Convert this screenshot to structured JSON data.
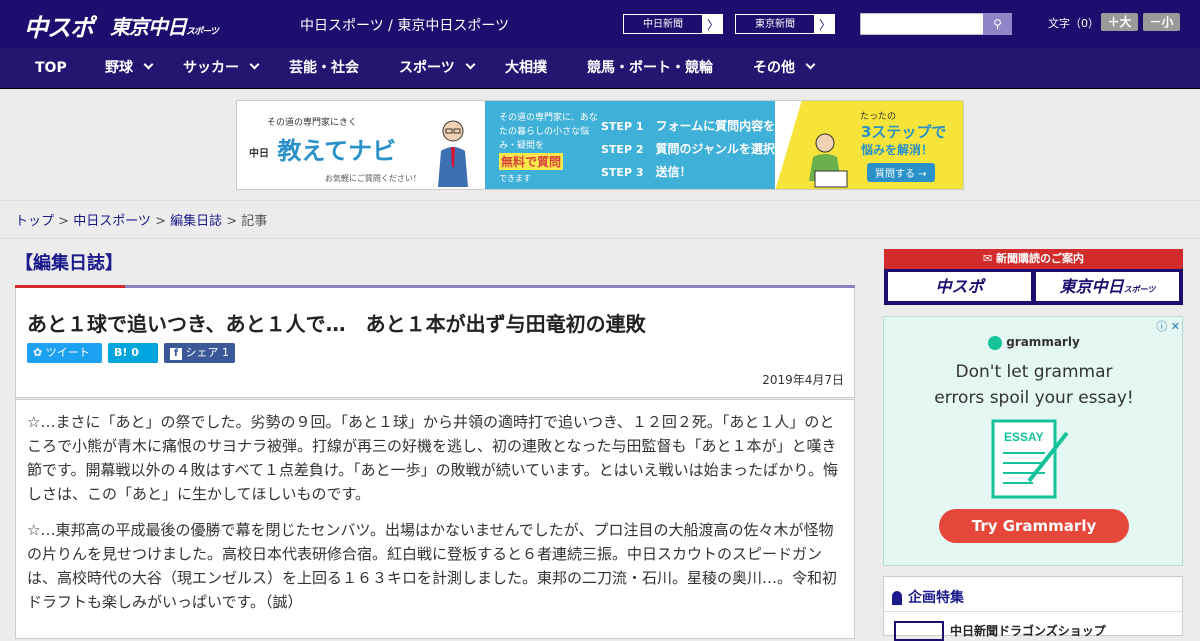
{
  "header": {
    "logo_chuspo": "中スポ",
    "logo_tokyo": "東京中日",
    "logo_tokyo_sub": "スポーツ",
    "site_name": "中日スポーツ / 東京中日スポーツ",
    "paper_links": [
      "中日新聞",
      "東京新聞"
    ],
    "font_label": "文字（0）",
    "font_larger": "＋大",
    "font_smaller": "－小"
  },
  "nav": [
    {
      "label": "TOP",
      "has_menu": false
    },
    {
      "label": "野球",
      "has_menu": true
    },
    {
      "label": "サッカー",
      "has_menu": true
    },
    {
      "label": "芸能・社会",
      "has_menu": false
    },
    {
      "label": "スポーツ",
      "has_menu": true
    },
    {
      "label": "大相撲",
      "has_menu": false
    },
    {
      "label": "競馬・ボート・競輪",
      "has_menu": false
    },
    {
      "label": "その他",
      "has_menu": true
    }
  ],
  "banner": {
    "catch": "その道の専門家にきく",
    "brand_small": "中日",
    "brand": "教えてナビ",
    "note": "お気軽にご質問ください！",
    "desc": "その道の専門家に、あなたの暮らしの小さな悩み・疑問を",
    "highlight": "無料で質問",
    "desc_end": "できます",
    "steps": [
      {
        "num": "STEP 1",
        "text": "フォームに質問内容を入力"
      },
      {
        "num": "STEP 2",
        "text": "質問のジャンルを選択"
      },
      {
        "num": "STEP 3",
        "text": "送信！"
      }
    ],
    "right_1": "たったの",
    "right_2": "3ステップで",
    "right_3": "悩みを解消！",
    "right_btn": "質問する →"
  },
  "breadcrumb": {
    "items": [
      "トップ",
      "中日スポーツ",
      "編集日誌"
    ],
    "current": "記事",
    "sep": " > "
  },
  "section": "【編集日誌】",
  "article": {
    "title": "あと１球で追いつき、あと１人で…　あと１本が出ず与田竜初の連敗",
    "tweet": "ツイート",
    "hatena": "B! 0",
    "share": "シェア 1",
    "date": "2019年4月7日",
    "paragraphs": [
      "☆…まさに「あと」の祭でした。劣勢の９回。「あと１球」から井領の適時打で追いつき、１２回２死。「あと１人」のところで小熊が青木に痛恨のサヨナラ被弾。打線が再三の好機を逃し、初の連敗となった与田監督も「あと１本が」と嘆き節です。開幕戦以外の４敗はすべて１点差負け。「あと一歩」の敗戦が続いています。とはいえ戦いは始まったばかり。悔しさは、この「あと」に生かしてほしいものです。",
      "☆…東邦高の平成最後の優勝で幕を閉じたセンバツ。出場はかないませんでしたが、プロ注目の大船渡高の佐々木が怪物の片りんを見せつけました。高校日本代表研修合宿。紅白戦に登板すると６者連続三振。中日スカウトのスピードガンは、高校時代の大谷（現エンゼルス）を上回る１６３キロを計測しました。東邦の二刀流・石川。星稜の奥川…。令和初ドラフトも楽しみがいっぱいです。（誠）"
    ]
  },
  "sidebar": {
    "subscribe_header": "新聞購読のご案内",
    "subscribe_1": "中スポ",
    "subscribe_2": "東京中日",
    "subscribe_2_sub": "スポーツ",
    "ad": {
      "brand": "grammarly",
      "line1": "Don't let grammar",
      "line2": "errors spoil your essay!",
      "doc_label": "ESSAY",
      "cta": "Try Grammarly",
      "ad_tag": "ⓘ ✕"
    },
    "feature_header": "企画特集",
    "feature_item": "中日新聞ドラゴンズショップ"
  },
  "colors": {
    "header_bg": "#1c0d6e",
    "nav_bg": "#231670",
    "accent_red": "#d12b2b",
    "link": "#1b1a8c",
    "twitter": "#1da1f2",
    "hatena": "#00a4de",
    "facebook": "#3b5998",
    "grammarly_red": "#e5473b"
  }
}
